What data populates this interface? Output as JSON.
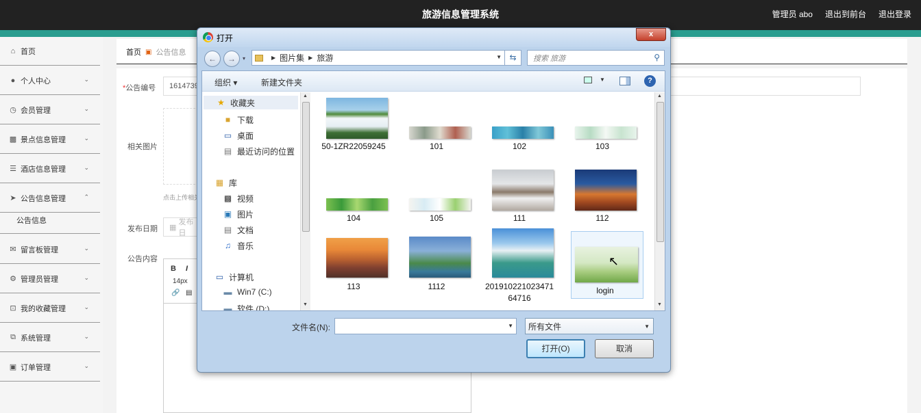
{
  "header": {
    "title": "旅游信息管理系统",
    "user": "管理员 abo",
    "to_front": "退出到前台",
    "logout": "退出登录"
  },
  "sidebar": {
    "items": [
      {
        "label": "首页",
        "icon": "home-icon"
      },
      {
        "label": "个人中心",
        "icon": "user-icon"
      },
      {
        "label": "会员管理",
        "icon": "clock-icon"
      },
      {
        "label": "景点信息管理",
        "icon": "clipboard-icon"
      },
      {
        "label": "酒店信息管理",
        "icon": "list-icon"
      },
      {
        "label": "公告信息管理",
        "icon": "send-icon"
      },
      {
        "label": "公告信息",
        "icon": ""
      },
      {
        "label": "留言板管理",
        "icon": "mail-icon"
      },
      {
        "label": "管理员管理",
        "icon": "settings-icon"
      },
      {
        "label": "我的收藏管理",
        "icon": "crop-icon"
      },
      {
        "label": "系统管理",
        "icon": "copy-icon"
      },
      {
        "label": "订单管理",
        "icon": "desktop-icon"
      }
    ]
  },
  "breadcrumb": {
    "home": "首页",
    "current": "公告信息"
  },
  "form": {
    "number_label": "公告编号",
    "number_value": "1614739",
    "image_label": "相关图片",
    "upload_hint": "点击上传相关",
    "date_label": "发布日期",
    "date_placeholder": "发布日",
    "content_label": "公告内容",
    "font_size": "14px"
  },
  "dialog": {
    "title": "打开",
    "path": [
      "图片集",
      "旅游"
    ],
    "search_placeholder": "搜索 旅游",
    "organize": "组织",
    "new_folder": "新建文件夹",
    "nav": [
      {
        "label": "收藏夹",
        "icon": "star-icon",
        "selected": true
      },
      {
        "label": "下载",
        "icon": "download-folder-icon"
      },
      {
        "label": "桌面",
        "icon": "desktop-icon"
      },
      {
        "label": "最近访问的位置",
        "icon": "recent-places-icon"
      },
      {
        "label": "库",
        "icon": "library-icon"
      },
      {
        "label": "视频",
        "icon": "video-icon"
      },
      {
        "label": "图片",
        "icon": "pictures-icon"
      },
      {
        "label": "文档",
        "icon": "documents-icon"
      },
      {
        "label": "音乐",
        "icon": "music-icon"
      },
      {
        "label": "计算机",
        "icon": "computer-icon"
      },
      {
        "label": "Win7 (C:)",
        "icon": "drive-icon"
      },
      {
        "label": "软件 (D:)",
        "icon": "drive-icon"
      }
    ],
    "files": [
      {
        "name": "50-1ZR22059245",
        "thumb": "waterfall"
      },
      {
        "name": "101",
        "thumb": "banner-light"
      },
      {
        "name": "102",
        "thumb": "banner-blue"
      },
      {
        "name": "103",
        "thumb": "banner-green-light"
      },
      {
        "name": "104",
        "thumb": "banner-green"
      },
      {
        "name": "105",
        "thumb": "banner-white"
      },
      {
        "name": "111",
        "thumb": "snow-town"
      },
      {
        "name": "112",
        "thumb": "city-night"
      },
      {
        "name": "113",
        "thumb": "sunset-city"
      },
      {
        "name": "1112",
        "thumb": "eiffel"
      },
      {
        "name": "20191022102347164716",
        "thumb": "lake-castle"
      },
      {
        "name": "login",
        "thumb": "login-landscape",
        "selected": true
      }
    ],
    "filename_label": "文件名(N):",
    "filename_value": "",
    "filetype": "所有文件",
    "open_button": "打开(O)",
    "cancel_button": "取消",
    "close_symbol": "x"
  }
}
